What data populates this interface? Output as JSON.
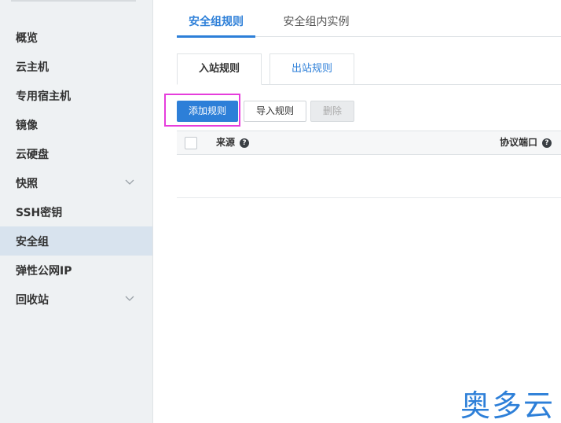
{
  "sidebar": {
    "items": [
      {
        "label": "概览",
        "active": false,
        "has_chevron": false
      },
      {
        "label": "云主机",
        "active": false,
        "has_chevron": false
      },
      {
        "label": "专用宿主机",
        "active": false,
        "has_chevron": false
      },
      {
        "label": "镜像",
        "active": false,
        "has_chevron": false
      },
      {
        "label": "云硬盘",
        "active": false,
        "has_chevron": false
      },
      {
        "label": "快照",
        "active": false,
        "has_chevron": true
      },
      {
        "label": "SSH密钥",
        "active": false,
        "has_chevron": false
      },
      {
        "label": "安全组",
        "active": true,
        "has_chevron": false
      },
      {
        "label": "弹性公网IP",
        "active": false,
        "has_chevron": false
      },
      {
        "label": "回收站",
        "active": false,
        "has_chevron": true
      }
    ]
  },
  "top_tabs": [
    {
      "label": "安全组规则",
      "active": true
    },
    {
      "label": "安全组内实例",
      "active": false
    }
  ],
  "sub_tabs": [
    {
      "label": "入站规则",
      "active": true
    },
    {
      "label": "出站规则",
      "active": false
    }
  ],
  "toolbar": {
    "add_rule_label": "添加规则",
    "import_rule_label": "导入规则",
    "delete_label": "删除"
  },
  "table": {
    "columns": [
      {
        "label": "来源",
        "help_icon": "question-circle-icon"
      },
      {
        "label": "协议端口",
        "help_icon": "question-circle-icon"
      }
    ],
    "rows": []
  },
  "watermark": {
    "text": "奥多云"
  },
  "colors": {
    "accent": "#2d7fd8",
    "sidebar_bg": "#eef1f3",
    "sidebar_active_bg": "#d8e3ee",
    "highlight": "#e63ddc"
  }
}
